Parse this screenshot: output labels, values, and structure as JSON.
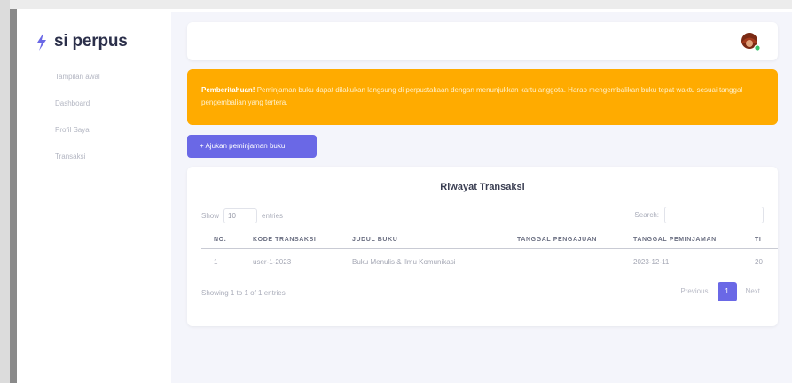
{
  "app": {
    "name": "si perpus",
    "brand_color": "#6a68e6",
    "alert_color": "#ffab00"
  },
  "sidebar": {
    "items": [
      {
        "label": "Tampilan awal"
      },
      {
        "label": "Dashboard"
      },
      {
        "label": "Profil Saya"
      },
      {
        "label": "Transaksi"
      }
    ]
  },
  "topbar": {
    "avatar_icon": "user-avatar-icon"
  },
  "alert": {
    "title": "Pemberitahuan!",
    "text": "Peminjaman buku dapat dilakukan langsung di perpustakaan dengan menunjukkan kartu anggota. Harap mengembalikan buku tepat waktu sesuai tanggal pengembalian yang tertera."
  },
  "actions": {
    "primary_label": "+ Ajukan peminjaman buku"
  },
  "card": {
    "title": "Riwayat Transaksi",
    "show_label": "Show",
    "entries_value": "10",
    "entries_label": "entries",
    "search_label": "Search:",
    "search_value": "",
    "columns": [
      "NO.",
      "KODE TRANSAKSI",
      "JUDUL BUKU",
      "TANGGAL PENGAJUAN",
      "TANGGAL PEMINJAMAN",
      "TI"
    ],
    "rows": [
      [
        "1",
        "user-1-2023",
        "Buku Menulis & Ilmu Komunikasi",
        "",
        "2023-12-11",
        "20"
      ]
    ],
    "info": "Showing 1 to 1 of 1 entries",
    "pagination": {
      "previous": "Previous",
      "current": "1",
      "next": "Next"
    }
  }
}
